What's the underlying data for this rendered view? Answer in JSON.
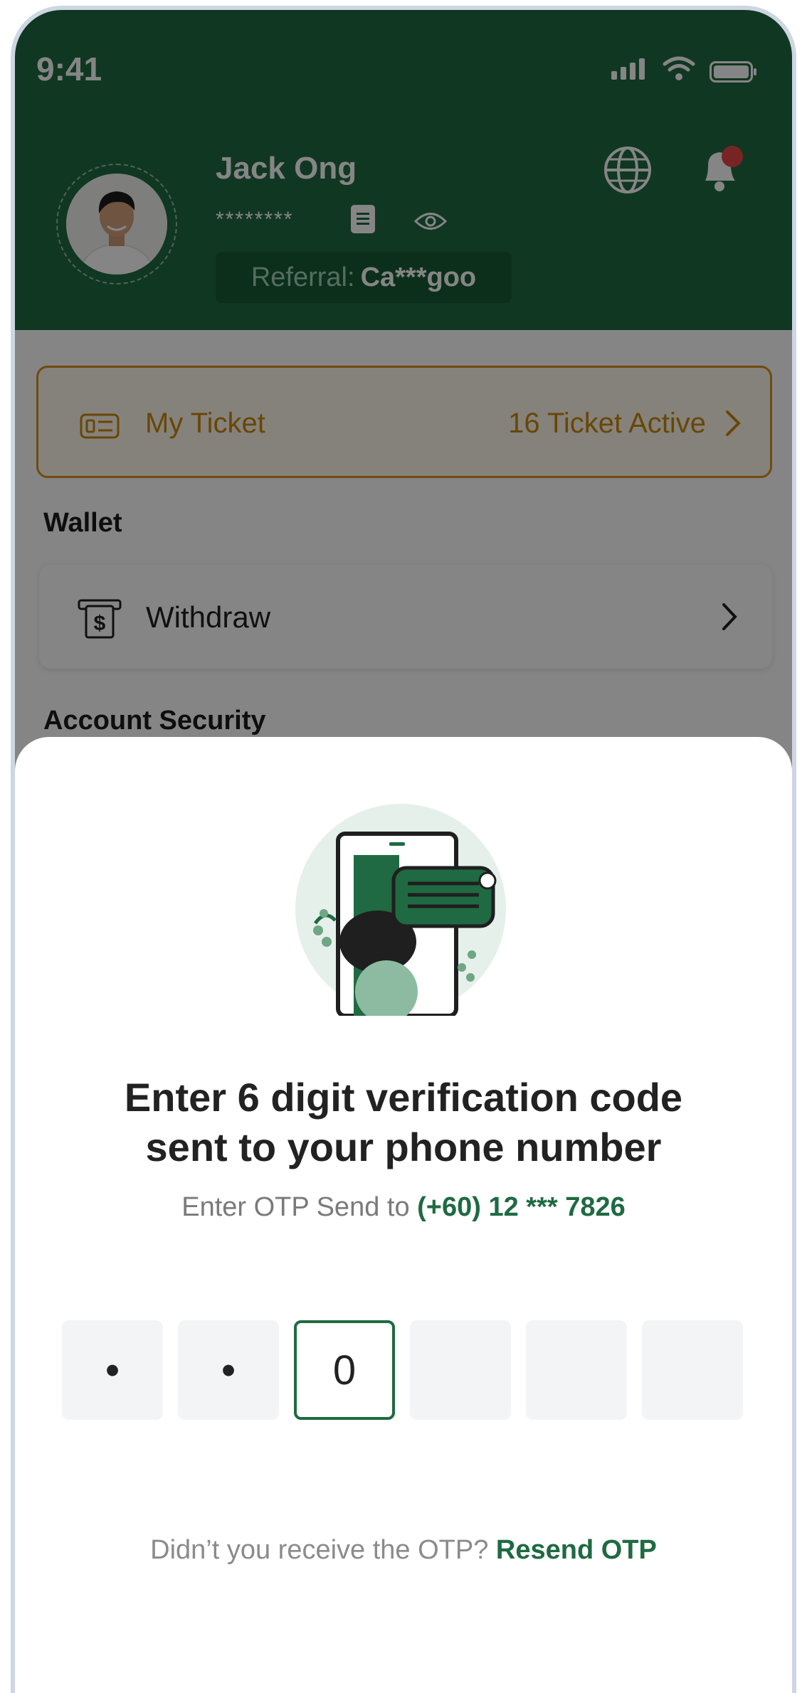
{
  "status_bar": {
    "time": "9:41"
  },
  "profile": {
    "name": "Jack Ong",
    "masked_id": "********",
    "referral_prefix": "Referral:",
    "referral_code": "Ca***goo"
  },
  "ticket": {
    "label": "My Ticket",
    "count_text": "16 Ticket Active"
  },
  "sections": {
    "wallet": "Wallet",
    "account_security": "Account Security"
  },
  "withdraw": {
    "label": "Withdraw"
  },
  "otp_sheet": {
    "title_line1": "Enter 6 digit verification code",
    "title_line2": "sent to your phone number",
    "subtitle_prefix": "Enter OTP Send to",
    "phone": "(+60) 12 *** 7826",
    "boxes": [
      "•",
      "•",
      "0",
      "",
      "",
      ""
    ],
    "resend_prompt": "Didn’t you receive the OTP?",
    "resend_link": "Resend OTP"
  },
  "colors": {
    "brand_green": "#1f6a42",
    "ticket_orange": "#d9901a",
    "notification_red": "#e84545"
  },
  "icons": [
    "signal-icon",
    "wifi-icon",
    "battery-icon",
    "copy-icon",
    "eye-icon",
    "globe-icon",
    "bell-icon",
    "ticket-icon",
    "chevron-right-icon",
    "atm-withdraw-icon"
  ]
}
